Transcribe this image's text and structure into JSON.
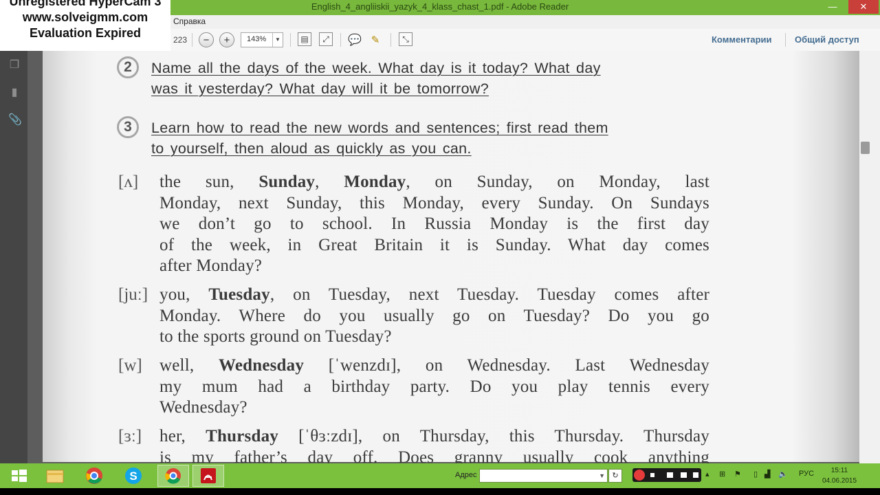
{
  "window": {
    "title": "English_4_angliiskii_yazyk_4_klass_chast_1.pdf - Adobe Reader"
  },
  "menu": {
    "help": "Справка"
  },
  "toolbar": {
    "page_count": "223",
    "zoom": "143%",
    "comments": "Комментарии",
    "share": "Общий доступ"
  },
  "watermark": {
    "line1": "Unregistered HyperCam 3",
    "line2": "www.solveigmm.com",
    "line3": "Evaluation Expired"
  },
  "document": {
    "tasks": [
      {
        "number": "2",
        "lines": [
          "Name all the days of the week. What day is it today? What day",
          "was it yesterday? What day will it be tomorrow?"
        ]
      },
      {
        "number": "3",
        "lines": [
          "Learn how to read the new words and sentences; first read them",
          "to yourself, then aloud as quickly as you can."
        ]
      }
    ],
    "blocks": [
      {
        "phonetic": "[ʌ]",
        "lines": [
          [
            "the sun, ",
            "Sunday",
            ", ",
            "Monday",
            ", on Sunday, on Monday, last"
          ],
          [
            "Monday, next Sunday, this Monday, every Sunday. On Sundays"
          ],
          [
            "we don’t go to school. In Russia Monday is the first day"
          ],
          [
            "of the week, in Great Britain it is Sunday. What day comes"
          ],
          [
            "after Monday?"
          ]
        ]
      },
      {
        "phonetic": "[juː]",
        "lines": [
          [
            "you, ",
            "Tuesday",
            ", on Tuesday, next Tuesday. Tuesday comes after"
          ],
          [
            "Monday. Where do you usually go on Tuesday? Do you go"
          ],
          [
            "to the sports ground on Tuesday?"
          ]
        ]
      },
      {
        "phonetic": "[w]",
        "lines": [
          [
            "well, ",
            "Wednesday",
            " [ˈwenzdɪ], on Wednesday. Last Wednesday"
          ],
          [
            "my mum had a birthday party. Do you play tennis every"
          ],
          [
            "Wednesday?"
          ]
        ]
      },
      {
        "phonetic": "[ɜː]",
        "lines": [
          [
            "her, ",
            "Thursday",
            " [ˈθɜːzdɪ], on Thursday, this Thursday. Thursday"
          ],
          [
            "is my father’s day off. Does granny usually cook anything"
          ]
        ]
      }
    ]
  },
  "taskbar": {
    "address_label": "Адрес",
    "lang": "РУС",
    "time": "15:11",
    "date": "04.06.2015"
  },
  "colors": {
    "taskbar": "#7bc13e",
    "titlebar": "#78b83c",
    "page_text": "#3a3a3a",
    "link": "#456d91"
  },
  "icons": [
    "windows-start-icon",
    "file-explorer-icon",
    "chrome-icon",
    "skype-icon",
    "adobe-reader-icon"
  ]
}
